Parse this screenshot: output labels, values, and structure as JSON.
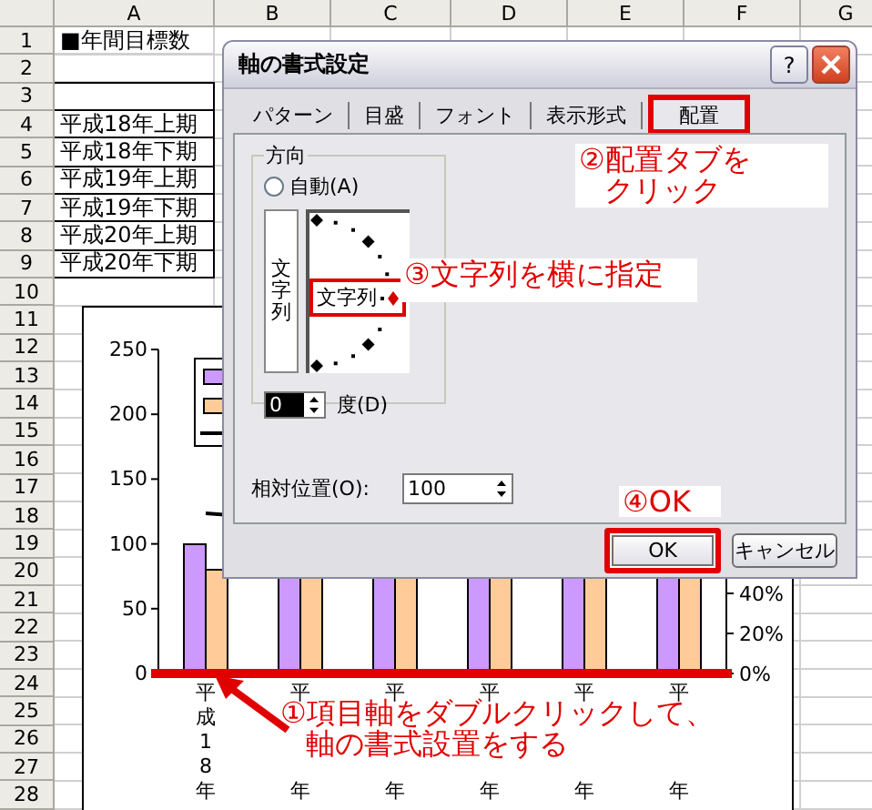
{
  "sheet": {
    "columns": [
      "A",
      "B",
      "C",
      "D",
      "E",
      "F",
      "G"
    ],
    "rows": [
      {
        "header": "1",
        "cell": "■年間目標数",
        "bordered": false
      },
      {
        "header": "2",
        "bordered": false
      },
      {
        "header": "3",
        "bordered": true
      },
      {
        "header": "4",
        "cell": "平成18年上期",
        "bordered": true
      },
      {
        "header": "5",
        "cell": "平成18年下期",
        "bordered": true
      },
      {
        "header": "6",
        "cell": "平成19年上期",
        "bordered": true
      },
      {
        "header": "7",
        "cell": "平成19年下期",
        "bordered": true
      },
      {
        "header": "8",
        "cell": "平成20年上期",
        "bordered": true
      },
      {
        "header": "9",
        "cell": "平成20年下期",
        "bordered": true
      },
      {
        "header": "10",
        "bordered": false
      },
      {
        "header": "11",
        "bordered": false
      },
      {
        "header": "12",
        "bordered": false
      },
      {
        "header": "13",
        "bordered": false
      },
      {
        "header": "14",
        "bordered": false
      },
      {
        "header": "15",
        "bordered": false
      },
      {
        "header": "16",
        "bordered": false
      },
      {
        "header": "17",
        "bordered": false
      },
      {
        "header": "18",
        "bordered": false
      },
      {
        "header": "19",
        "bordered": false
      },
      {
        "header": "20",
        "bordered": false
      },
      {
        "header": "21",
        "bordered": false
      },
      {
        "header": "22",
        "bordered": false
      },
      {
        "header": "23",
        "bordered": false
      },
      {
        "header": "24",
        "bordered": false
      },
      {
        "header": "25",
        "bordered": false
      },
      {
        "header": "26",
        "bordered": false
      },
      {
        "header": "27",
        "bordered": false
      },
      {
        "header": "28",
        "bordered": false
      }
    ]
  },
  "chart": {
    "axis_selected": true,
    "y_axis_labels": [
      "250",
      "200",
      "150",
      "100",
      "50",
      "0"
    ],
    "right_axis_labels": [
      "40%",
      "20%",
      "0%"
    ],
    "legend": [
      {
        "color": "#cc99ff"
      },
      {
        "color": "#ffcc99"
      }
    ],
    "category_labels": [
      [
        "平成18年"
      ],
      [
        "平",
        "年"
      ],
      [
        "平",
        "年"
      ],
      [
        "平",
        "年"
      ],
      [
        "平",
        "年"
      ],
      [
        "平",
        "年"
      ]
    ]
  },
  "dialog": {
    "title": "軸の書式設定",
    "help": "?",
    "tabs": [
      {
        "label": "パターン",
        "selected": false,
        "highlighted": false
      },
      {
        "label": "目盛",
        "selected": false,
        "highlighted": false
      },
      {
        "label": "フォント",
        "selected": false,
        "highlighted": false
      },
      {
        "label": "表示形式",
        "selected": false,
        "highlighted": false
      },
      {
        "label": "配置",
        "selected": true,
        "highlighted": true
      }
    ],
    "orientation": {
      "group_label": "方向",
      "auto": {
        "label": "自動(A)",
        "selected": false
      },
      "vertical_sample": "文字列",
      "dial_label": "文字列",
      "dial_highlighted": true,
      "degrees": {
        "value": "0",
        "label": "度(D)"
      }
    },
    "offset": {
      "label": "相対位置(O):",
      "value": "100"
    },
    "buttons": [
      {
        "label": "OK",
        "highlighted": true
      },
      {
        "label": "キャンセル",
        "highlighted": false
      }
    ]
  },
  "callouts": [
    {
      "kind": "box",
      "lines": [
        "②配置タブを",
        "クリック"
      ]
    },
    {
      "kind": "box",
      "lines": [
        "③文字列を横に指定"
      ]
    },
    {
      "kind": "box",
      "lines": [
        "④OK"
      ]
    },
    {
      "kind": "arrow",
      "lines": [
        "①項目軸をダブルクリックして、",
        "軸の書式設置をする"
      ]
    }
  ]
}
